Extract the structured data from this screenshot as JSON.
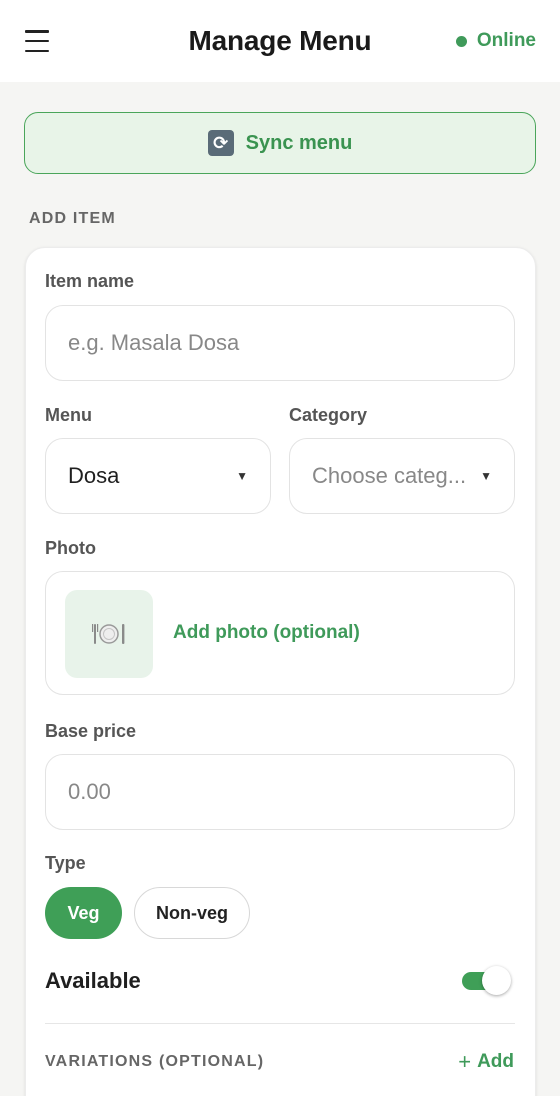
{
  "header": {
    "title": "Manage Menu",
    "status": "Online",
    "status_color": "#3f9a5a"
  },
  "sync": {
    "label": "Sync menu",
    "icon": "sync-icon"
  },
  "section": {
    "add_item": "ADD ITEM"
  },
  "form": {
    "item_name": {
      "label": "Item name",
      "placeholder": "e.g. Masala Dosa",
      "value": ""
    },
    "menu": {
      "label": "Menu",
      "value": "Dosa"
    },
    "category": {
      "label": "Category",
      "placeholder": "Choose categ..."
    },
    "photo": {
      "label": "Photo",
      "action": "Add photo (optional)",
      "icon": "plate-icon"
    },
    "base_price": {
      "label": "Base price",
      "placeholder": "0.00"
    },
    "type": {
      "label": "Type",
      "options": [
        "Veg",
        "Non-veg"
      ],
      "selected": "Veg"
    },
    "available": {
      "label": "Available",
      "on": true
    },
    "variations": {
      "label": "VARIATIONS (OPTIONAL)",
      "add_label": "Add"
    }
  },
  "colors": {
    "accent": "#3f9f57",
    "background": "#f5f5f3",
    "sync_bg": "#e8f4e8"
  }
}
